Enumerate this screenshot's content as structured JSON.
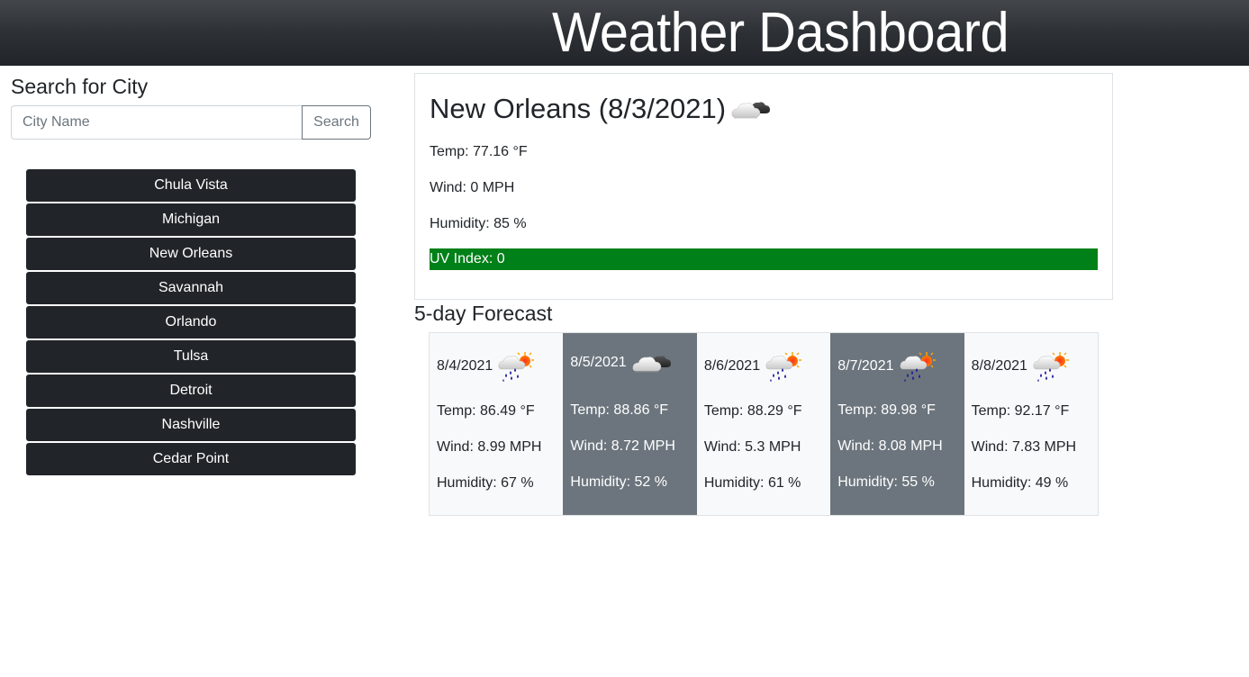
{
  "header": {
    "title": "Weather Dashboard"
  },
  "search": {
    "heading": "Search for City",
    "placeholder": "City Name",
    "value": "",
    "button_label": "Search"
  },
  "history": [
    {
      "label": "Chula Vista"
    },
    {
      "label": "Michigan"
    },
    {
      "label": "New Orleans"
    },
    {
      "label": "Savannah"
    },
    {
      "label": "Orlando"
    },
    {
      "label": "Tulsa"
    },
    {
      "label": "Detroit"
    },
    {
      "label": "Nashville"
    },
    {
      "label": "Cedar Point"
    }
  ],
  "current": {
    "title": "New Orleans (8/3/2021)",
    "icon": "night-cloudy-icon",
    "temp": "Temp: 77.16 °F",
    "wind": "Wind: 0 MPH",
    "humidity": "Humidity: 85 %",
    "uv": "UV Index: 0",
    "uv_value": 0,
    "uv_color": "#008018"
  },
  "forecast": {
    "heading": "5-day Forecast",
    "days": [
      {
        "date": "8/4/2021",
        "icon": "rain-sun-icon",
        "temp": "Temp: 86.49 °F",
        "wind": "Wind: 8.99 MPH",
        "humidity": "Humidity: 67 %",
        "style": "light"
      },
      {
        "date": "8/5/2021",
        "icon": "night-cloudy-icon",
        "temp": "Temp: 88.86 °F",
        "wind": "Wind: 8.72 MPH",
        "humidity": "Humidity: 52 %",
        "style": "dark"
      },
      {
        "date": "8/6/2021",
        "icon": "rain-sun-icon",
        "temp": "Temp: 88.29 °F",
        "wind": "Wind: 5.3 MPH",
        "humidity": "Humidity: 61 %",
        "style": "light"
      },
      {
        "date": "8/7/2021",
        "icon": "rain-sun-icon",
        "temp": "Temp: 89.98 °F",
        "wind": "Wind: 8.08 MPH",
        "humidity": "Humidity: 55 %",
        "style": "dark"
      },
      {
        "date": "8/8/2021",
        "icon": "rain-sun-icon",
        "temp": "Temp: 92.17 °F",
        "wind": "Wind: 7.83 MPH",
        "humidity": "Humidity: 49 %",
        "style": "light"
      }
    ]
  }
}
